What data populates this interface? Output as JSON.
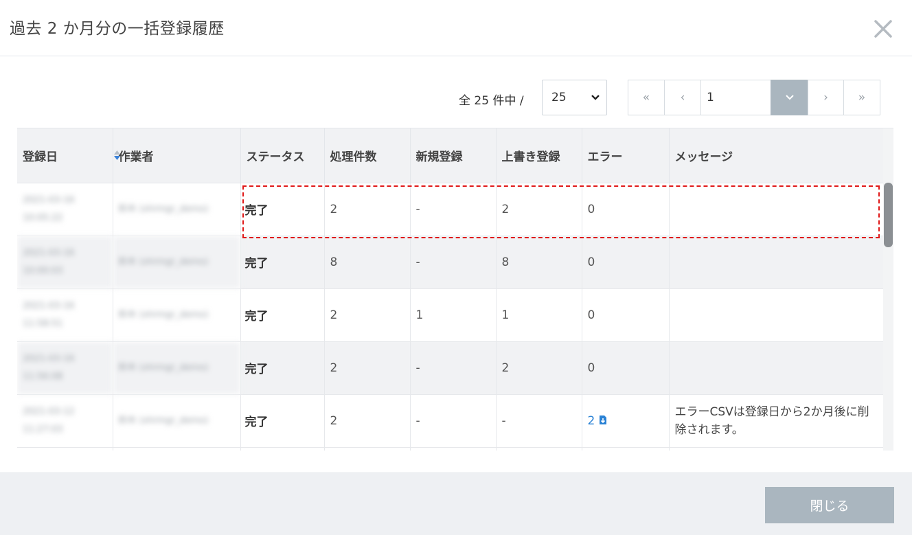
{
  "dialog": {
    "title": "過去 2 か月分の一括登録履歴",
    "close_icon": "close-icon"
  },
  "pager": {
    "summary": "全 25 件中 /",
    "per_page": "25",
    "first_label": "«",
    "prev_label": "‹",
    "current_page": "1",
    "next_label": "›",
    "last_label": "»"
  },
  "table": {
    "columns": [
      "登録日",
      "作業者",
      "ステータス",
      "処理件数",
      "新規登録",
      "上書き登録",
      "エラー",
      "メッセージ"
    ],
    "rows": [
      {
        "date": "2021-03-16 10:05:22",
        "operator": "鈴木 (xhrmgr_demo)",
        "status": "完了",
        "processed": "2",
        "new": "-",
        "overwrite": "2",
        "error": "0",
        "message": ""
      },
      {
        "date": "2021-03-16 10:00:03",
        "operator": "鈴木 (xhrmgr_demo)",
        "status": "完了",
        "processed": "8",
        "new": "-",
        "overwrite": "8",
        "error": "0",
        "message": ""
      },
      {
        "date": "2021-03-16 11:58:51",
        "operator": "鈴木 (xhrmgr_demo)",
        "status": "完了",
        "processed": "2",
        "new": "1",
        "overwrite": "1",
        "error": "0",
        "message": ""
      },
      {
        "date": "2021-03-16 11:56:08",
        "operator": "鈴木 (xhrmgr_demo)",
        "status": "完了",
        "processed": "2",
        "new": "-",
        "overwrite": "2",
        "error": "0",
        "message": ""
      },
      {
        "date": "2021-03-12 11:27:03",
        "operator": "鈴木 (xhrmgr_demo)",
        "status": "完了",
        "processed": "2",
        "new": "-",
        "overwrite": "-",
        "error": "2",
        "message": "エラーCSVは登録日から2か月後に削除されます。"
      }
    ]
  },
  "footer": {
    "close_label": "閉じる"
  },
  "colors": {
    "accent": "#aab6bf",
    "link": "#2a82d5",
    "highlight": "#e01818"
  }
}
